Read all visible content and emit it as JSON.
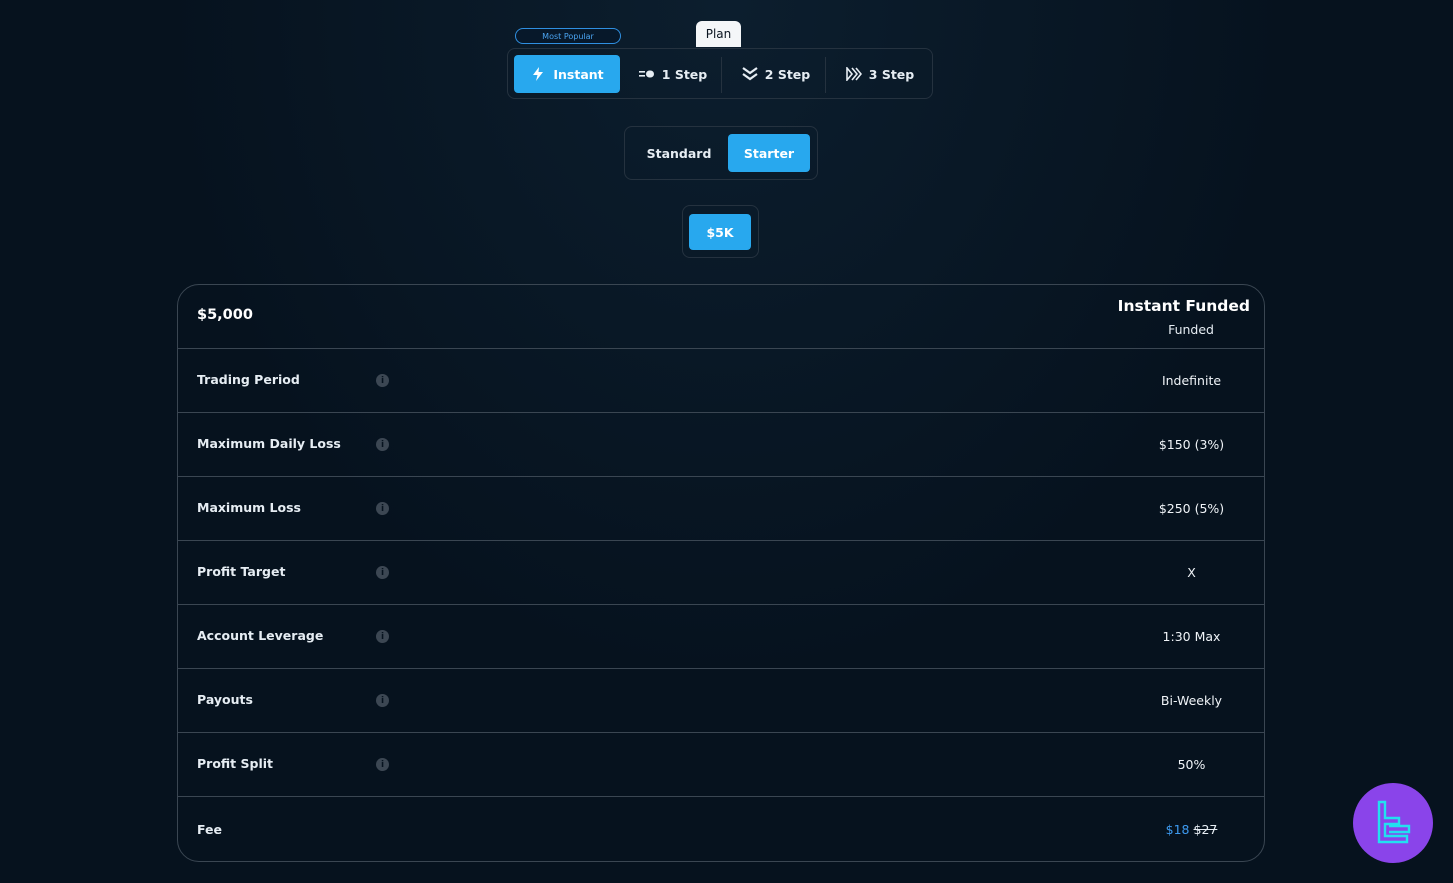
{
  "plan_selector": {
    "caption": "Plan",
    "badge": "Most Popular",
    "tabs": [
      {
        "label": "Instant",
        "icon": "lightning-icon",
        "active": true
      },
      {
        "label": "1 Step",
        "icon": "dash-arrow-icon",
        "active": false
      },
      {
        "label": "2 Step",
        "icon": "double-chevron-down-icon",
        "active": false
      },
      {
        "label": "3 Step",
        "icon": "triple-chevron-right-icon",
        "active": false
      }
    ]
  },
  "type_toggle": {
    "options": [
      {
        "label": "Standard",
        "active": false
      },
      {
        "label": "Starter",
        "active": true
      }
    ]
  },
  "account_size": {
    "options": [
      {
        "label": "$5K",
        "active": true
      }
    ]
  },
  "table": {
    "amount": "$5,000",
    "plan_name": "Instant Funded",
    "plan_subtitle": "Funded",
    "rows": [
      {
        "label": "Trading Period",
        "value": "Indefinite"
      },
      {
        "label": "Maximum Daily Loss",
        "value": "$150 (3%)"
      },
      {
        "label": "Maximum Loss",
        "value": "$250 (5%)"
      },
      {
        "label": "Profit Target",
        "value": "X"
      },
      {
        "label": "Account Leverage",
        "value": "1:30 Max"
      },
      {
        "label": "Payouts",
        "value": "Bi-Weekly"
      },
      {
        "label": "Profit Split",
        "value": "50%"
      }
    ],
    "fee": {
      "label": "Fee",
      "price": "$18",
      "original_price": "$27"
    }
  },
  "colors": {
    "background": "#06121e",
    "accent": "#28a8ee",
    "fee_price": "#3d9af0",
    "logo_badge": "#8a44ea"
  },
  "logo": {
    "icon": "brand-logo-icon"
  }
}
